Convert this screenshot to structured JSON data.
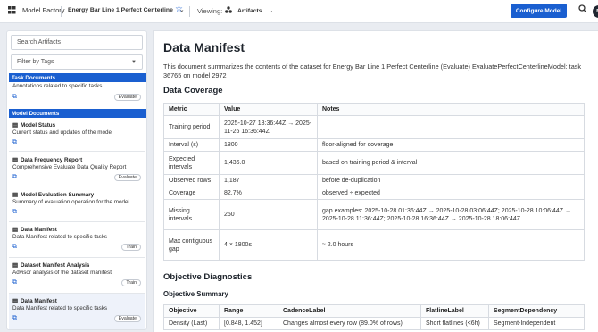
{
  "topbar": {
    "app_title": "Model Factory",
    "project": "Energy Bar Line 1 Perfect Centerline",
    "viewing_label": "Viewing:",
    "viewing_value": "Artifacts",
    "configure_button": "Configure Model",
    "avatar_initials": "BI",
    "accent": "#1a5fd0"
  },
  "sidebar": {
    "search_placeholder": "Search Artifacts",
    "filter_label": "Filter by Tags",
    "sections": [
      {
        "label": "Task Documents",
        "items": [
          {
            "title": "",
            "desc": "Annotations related to specific tasks",
            "tag": "Evaluate"
          }
        ]
      },
      {
        "label": "Model Documents",
        "items": [
          {
            "title": "Model Status",
            "desc": "Current status and updates of the model",
            "tag": ""
          },
          {
            "title": "Data Frequency Report",
            "desc": "Comprehensive Evaluate Data Quality Report",
            "tag": "Evaluate"
          },
          {
            "title": "Model Evaluation Summary",
            "desc": "Summary of evaluation operation for the model",
            "tag": ""
          },
          {
            "title": "Data Manifest",
            "desc": "Data Manifest related to specific tasks",
            "tag": "Train"
          },
          {
            "title": "Dataset Manifest Analysis",
            "desc": "Advisor analysis of the dataset manifest",
            "tag": "Train"
          },
          {
            "title": "Data Manifest",
            "desc": "Data Manifest related to specific tasks",
            "tag": "Evaluate"
          }
        ]
      }
    ]
  },
  "main": {
    "title": "Data Manifest",
    "intro": "This document summarizes the contents of the dataset for Energy Bar Line 1 Perfect Centerline (Evaluate) EvaluatePerfectCenterlineModel: task 36765 on model 2972",
    "coverage_heading": "Data Coverage",
    "coverage_headers": [
      "Metric",
      "Value",
      "Notes"
    ],
    "coverage_rows": [
      [
        "Training period",
        "2025-10-27 18:36:44Z → 2025-11-26 16:36:44Z",
        ""
      ],
      [
        "Interval (s)",
        "1800",
        "floor-aligned for coverage"
      ],
      [
        "Expected intervals",
        "1,436.0",
        "based on training period & interval"
      ],
      [
        "Observed rows",
        "1,187",
        "before de-duplication"
      ],
      [
        "Coverage",
        "82.7%",
        "observed ÷ expected"
      ],
      [
        "Missing intervals",
        "250",
        "gap examples: 2025-10-28 01:36:44Z → 2025-10-28 03:06:44Z; 2025-10-28 10:06:44Z → 2025-10-28 11:36:44Z; 2025-10-28 16:36:44Z → 2025-10-28 18:06:44Z"
      ],
      [
        "Max contiguous gap",
        "4 × 1800s",
        "≈ 2.0 hours"
      ]
    ],
    "objective_heading": "Objective Diagnostics",
    "objective_summary_heading": "Objective Summary",
    "objective_headers": [
      "Objective",
      "Range",
      "CadenceLabel",
      "FlatlineLabel",
      "SegmentDependency"
    ],
    "objective_rows": [
      [
        "Density (Last)",
        "[0.848, 1.452]",
        "Changes almost every row (89.0% of rows)",
        "Short flatlines (<6h)",
        "Segment-Independent"
      ]
    ]
  }
}
